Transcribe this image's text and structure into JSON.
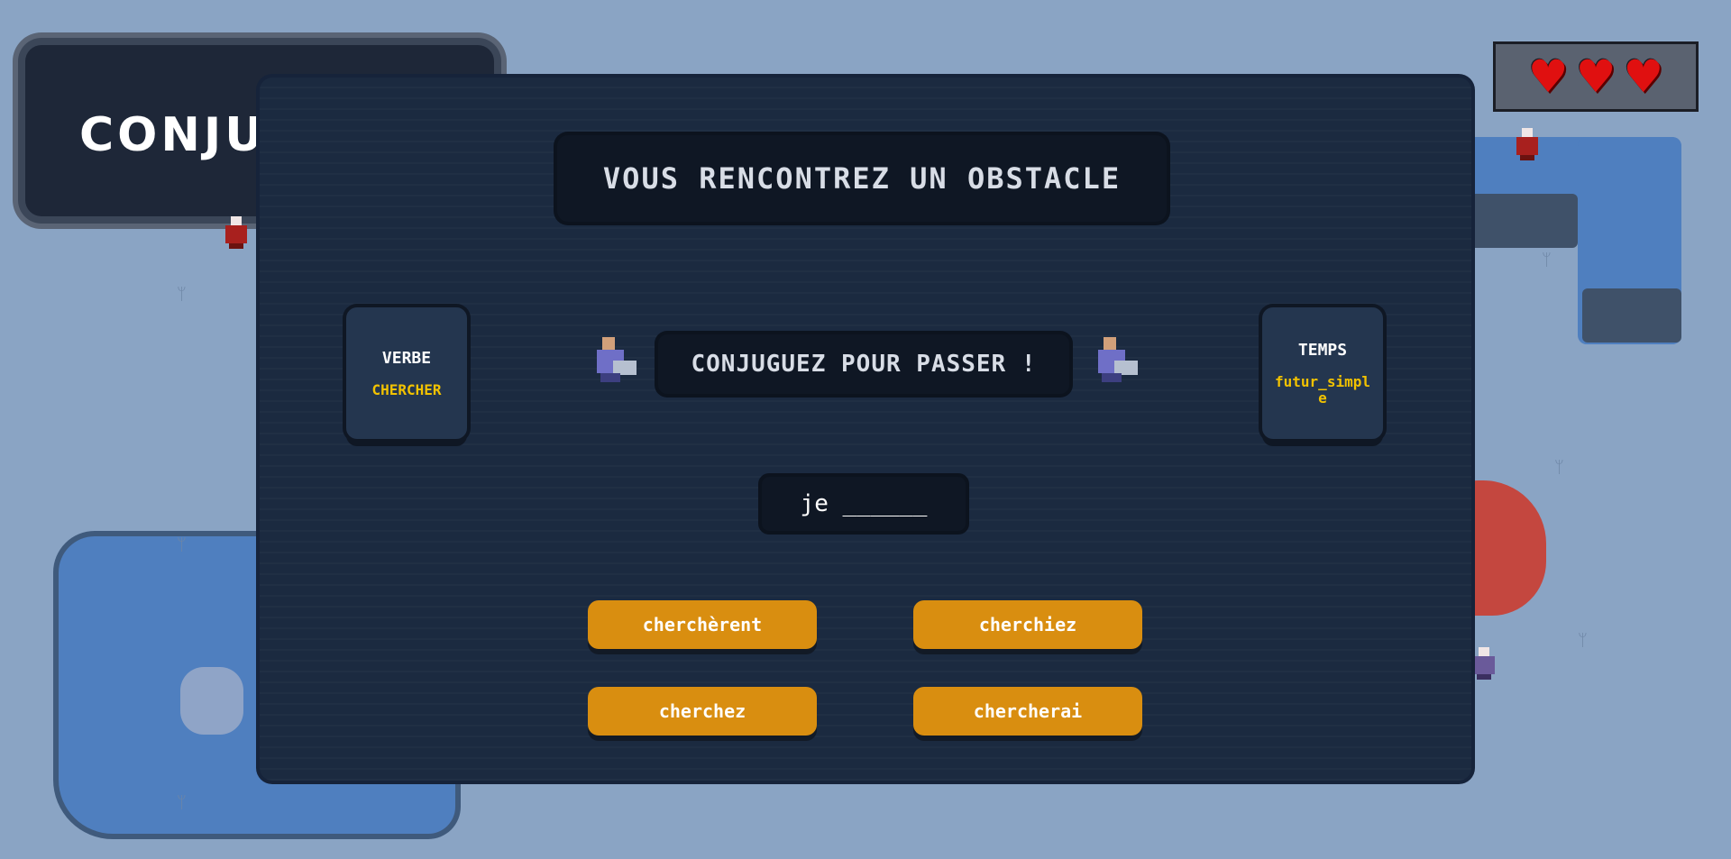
{
  "game": {
    "title_partial": "CONJUG",
    "lives": 3
  },
  "hearts": [
    "heart",
    "heart",
    "heart"
  ],
  "modal": {
    "banner": "VOUS RENCONTREZ UN OBSTACLE",
    "prompt": "CONJUGUEZ POUR PASSER !",
    "verb_card": {
      "label": "VERBE",
      "value": "CHERCHER"
    },
    "tense_card": {
      "label": "TEMPS",
      "value": "futur_simple"
    },
    "sentence": "je ______",
    "options": [
      "cherchèrent",
      "cherchiez",
      "cherchez",
      "chercherai"
    ]
  },
  "colors": {
    "background": "#8aa4c4",
    "modal": "#1b2a40",
    "option_button": "#d98e10",
    "value_text": "#f2c200",
    "heart": "#e01010"
  }
}
